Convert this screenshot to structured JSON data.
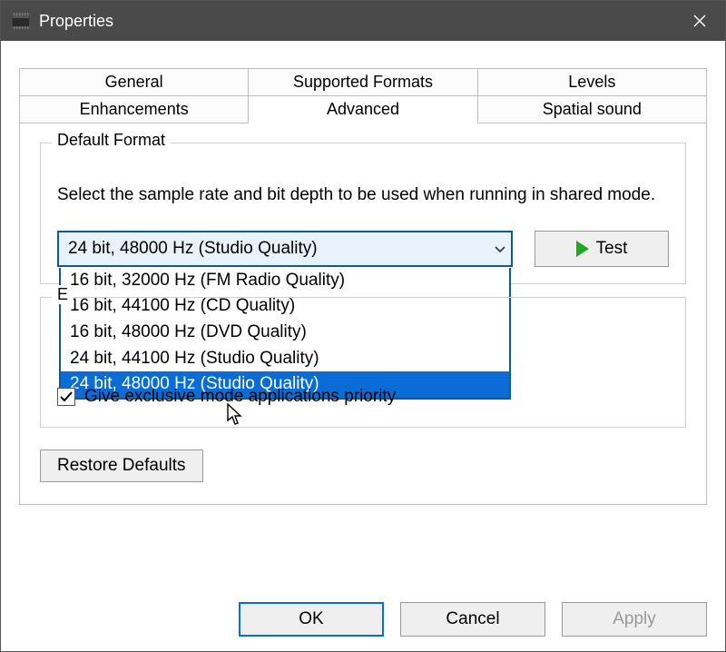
{
  "window": {
    "title": "Properties"
  },
  "tabs": {
    "row1": [
      "General",
      "Supported Formats",
      "Levels"
    ],
    "row2": [
      "Enhancements",
      "Advanced",
      "Spatial sound"
    ],
    "active": "Advanced"
  },
  "default_format": {
    "legend": "Default Format",
    "explain": "Select the sample rate and bit depth to be used when running in shared mode.",
    "selected": "24 bit, 48000 Hz (Studio Quality)",
    "options": [
      "16 bit, 32000 Hz (FM Radio Quality)",
      "16 bit, 44100 Hz (CD Quality)",
      "16 bit, 48000 Hz (DVD Quality)",
      "24 bit, 44100 Hz (Studio Quality)",
      "24 bit, 48000 Hz (Studio Quality)"
    ],
    "selected_index": 4,
    "test_label": "Test"
  },
  "exclusive_mode": {
    "legend_first_char": "E",
    "give_priority_label": "Give exclusive mode applications priority",
    "give_priority_checked": true
  },
  "restore_defaults_label": "Restore Defaults",
  "footer": {
    "ok": "OK",
    "cancel": "Cancel",
    "apply": "Apply"
  }
}
